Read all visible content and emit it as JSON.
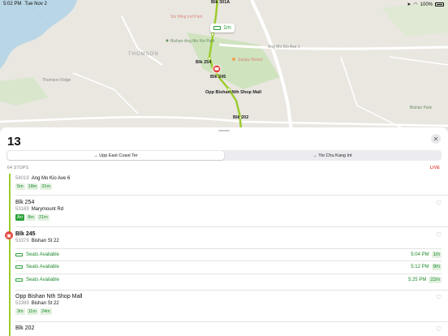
{
  "status_bar": {
    "time": "5:02 PM",
    "date": "Tue Nov 2",
    "battery": "100%",
    "icons": [
      "location-arrow-icon",
      "wifi-icon",
      "battery-icon"
    ]
  },
  "map": {
    "area_label": "THOMSON",
    "places": [
      {
        "name": "Sin Ming Ind Park",
        "kind": "place"
      },
      {
        "name": "Bishan-Ang Mo Kio Park",
        "kind": "park"
      },
      {
        "name": "Thomson Ridge",
        "kind": "place"
      },
      {
        "name": "Sanjay Bistari",
        "kind": "poi"
      },
      {
        "name": "Ang Mo Kio Ave 1",
        "kind": "road"
      },
      {
        "name": "Bishan Park",
        "kind": "park"
      }
    ],
    "route_stops": [
      "Blk 301A",
      "Blk 254",
      "Blk 245",
      "Opp Bishan Nth Shop Mall",
      "Blk 202"
    ],
    "selected_stop": "Blk 245",
    "eta_chip": {
      "label": "1m",
      "icon": "bus-icon"
    },
    "route_color": "#9ccc2d"
  },
  "sheet": {
    "route_number": "13",
    "close_icon": "close-icon",
    "directions": [
      {
        "label": "→ Upp East Coast Ter",
        "active": true
      },
      {
        "label": "→ Yio Chu Kang Int",
        "active": false
      }
    ],
    "stops_count": "64 STOPS",
    "live_label": "LIVE",
    "live_color": "#e2453c",
    "stops": [
      {
        "name": "",
        "code": "54019",
        "road": "Ang Mo Kio Ave 6",
        "times": [
          "5m",
          "18m",
          "31m"
        ],
        "arr_solid": false
      },
      {
        "name": "Blk 254",
        "code": "53169",
        "road": "Marymount Rd",
        "times": [
          "Arr",
          "8m",
          "21m"
        ],
        "arr_solid": true
      },
      {
        "name": "Blk 245",
        "code": "53379",
        "road": "Bishan St 22",
        "selected": true
      },
      {
        "name": "Opp Bishan Nth Shop Mall",
        "code": "53389",
        "road": "Bishan St 22",
        "times": [
          "3m",
          "11m",
          "24m"
        ],
        "arr_solid": false
      },
      {
        "name": "Blk 202",
        "code": "",
        "road": ""
      }
    ],
    "arrivals": [
      {
        "status": "Seats Available",
        "time": "5:04 PM",
        "eta": "1m"
      },
      {
        "status": "Seats Available",
        "time": "5:12 PM",
        "eta": "9m"
      },
      {
        "status": "Seats Available",
        "time": "5:25 PM",
        "eta": "22m"
      }
    ],
    "accent_color": "#2aa33a"
  }
}
